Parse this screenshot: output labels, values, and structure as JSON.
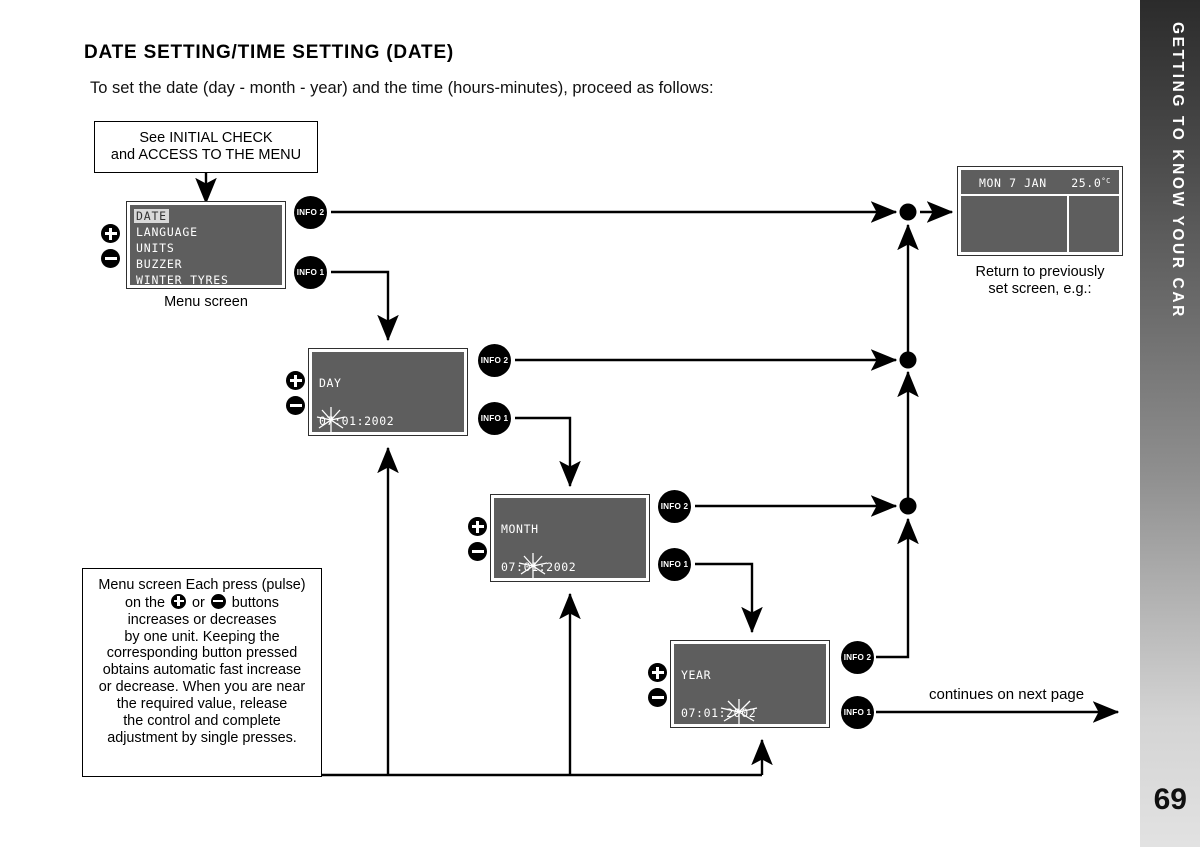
{
  "page": {
    "number": "69",
    "section_tab": "GETTING TO KNOW YOUR CAR",
    "title": "DATE SETTING/TIME SETTING (DATE)",
    "intro": "To set the date (day - month - year) and the time (hours-minutes), proceed as follows:"
  },
  "colors": {
    "lcd_background": "#5e5e5e",
    "lcd_text": "#ffffff",
    "lcd_highlight": "#d9d9d9",
    "ink": "#000000",
    "tab_gradient_top": "#2b2b2b",
    "tab_gradient_bottom": "#e2e2e2"
  },
  "start_box": {
    "line1": "See INITIAL CHECK",
    "line2": "and ACCESS TO THE MENU"
  },
  "menu_screen": {
    "caption": "Menu screen",
    "items": [
      {
        "label": "DATE",
        "selected": true
      },
      {
        "label": "LANGUAGE",
        "selected": false
      },
      {
        "label": "UNITS",
        "selected": false
      },
      {
        "label": "BUZZER",
        "selected": false
      },
      {
        "label": "WINTER TYRES",
        "selected": false
      }
    ],
    "info2": "INFO 2",
    "info1": "INFO 1"
  },
  "return_screen": {
    "day_date": "MON 7 JAN",
    "temperature": "25.0",
    "temperature_unit": "°C",
    "caption_line1": "Return to  previously",
    "caption_line2": "set screen, e.g.:"
  },
  "steps": [
    {
      "id": "day",
      "label": "DAY",
      "value": "07:01:2002",
      "value_parts": [
        {
          "text": "07",
          "flashing": true
        },
        {
          "text": ":01:2002",
          "flashing": false
        }
      ],
      "info2": "INFO 2",
      "info1": "INFO 1"
    },
    {
      "id": "month",
      "label": "MONTH",
      "value": "07:01:2002",
      "value_parts": [
        {
          "text": "07:",
          "flashing": false
        },
        {
          "text": "01",
          "flashing": true
        },
        {
          "text": ":2002",
          "flashing": false
        }
      ],
      "info2": "INFO 2",
      "info1": "INFO 1"
    },
    {
      "id": "year",
      "label": "YEAR",
      "value": "07:01:2002",
      "value_parts": [
        {
          "text": "07:01:",
          "flashing": false
        },
        {
          "text": "2002",
          "flashing": true
        }
      ],
      "info2": "INFO 2",
      "info1": "INFO 1"
    }
  ],
  "note": {
    "text": "Menu screen Each press (pulse) on the ➕ or ➖ buttons increases or decreases by one unit. Keeping the corresponding button pressed obtains automatic fast increase or decrease. When you are near the required value, release the control and complete adjustment by single presses.",
    "line1_a": "Menu screen Each press (pulse)",
    "line2_a": "on the",
    "line2_b": "or",
    "line2_c": "buttons",
    "line3": "increases or decreases",
    "line4": "by one unit. Keeping the",
    "line5": "corresponding button pressed",
    "line6": "obtains automatic fast increase",
    "line7": "or decrease. When you are near",
    "line8": "the required value, release",
    "line9": "the control and complete",
    "line10": "adjustment by single presses."
  },
  "continues": "continues on next page",
  "buttons": {
    "plus": "+",
    "minus": "-"
  }
}
